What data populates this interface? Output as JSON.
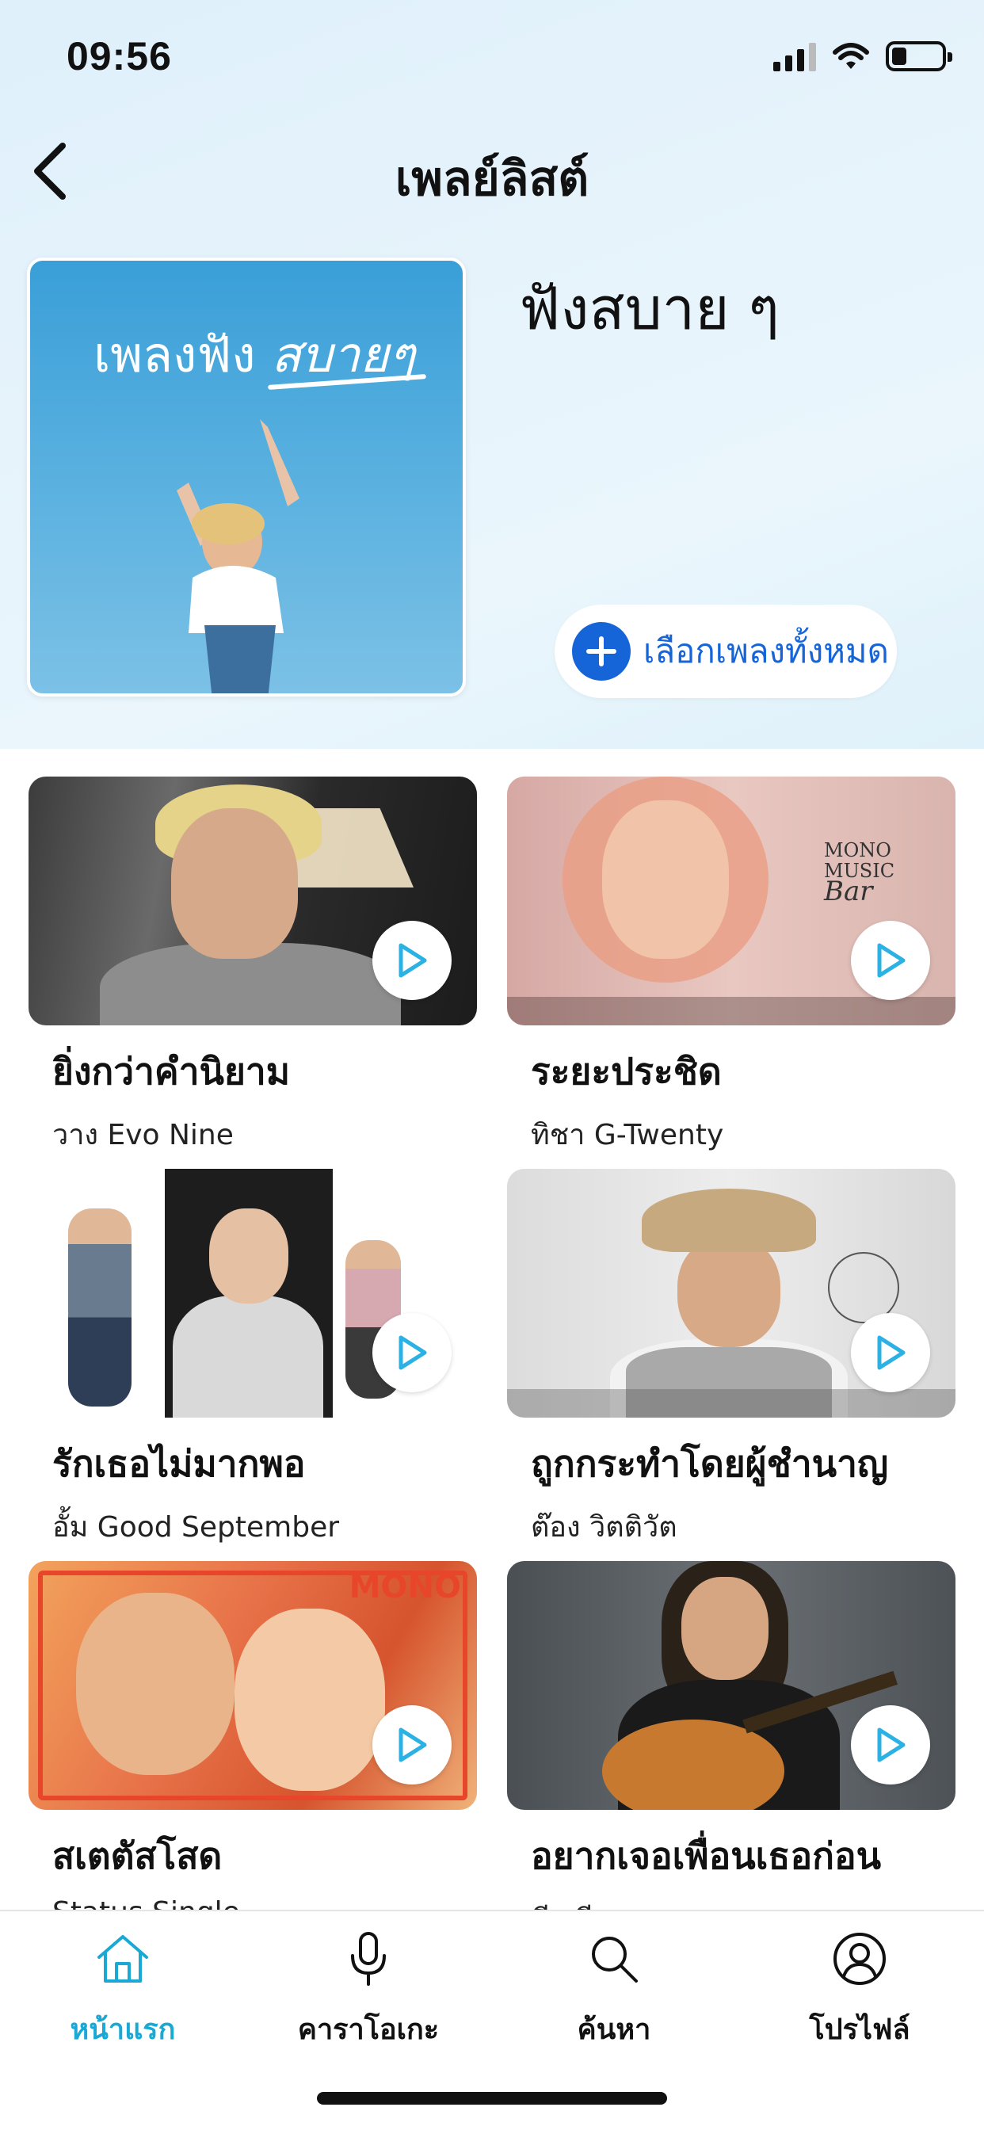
{
  "status": {
    "time": "09:56"
  },
  "nav": {
    "title": "เพลย์ลิสต์",
    "back_icon": "chevron-left-icon"
  },
  "playlist": {
    "cover_text_a": "เพลงฟัง",
    "cover_text_b": "สบายๆ",
    "name": "ฟังสบาย ๆ",
    "select_all_label": "เลือกเพลงทั้งหมด"
  },
  "songs": [
    {
      "title": "ยิ่งกว่าคำนิยาม",
      "artist": "วาง Evo Nine"
    },
    {
      "title": "ระยะประชิด",
      "artist": "ทิชา G-Twenty"
    },
    {
      "title": "รักเธอไม่มากพอ",
      "artist": "อั้ม Good September"
    },
    {
      "title": "ถูกกระทำโดยผู้ชำนาญ",
      "artist": "ต๊อง วิตติวัต"
    },
    {
      "title": "สเตตัสโสด",
      "artist": "Status Single"
    },
    {
      "title": "อยากเจอเพื่อนเธอก่อน",
      "artist": "พีร พีระ"
    }
  ],
  "thumb_text": {
    "mono_music": "MONO",
    "music": "MUSIC",
    "bar": "Bar",
    "mono_logo": "MONO"
  },
  "tabs": [
    {
      "label": "หน้าแรก",
      "icon": "home-icon",
      "active": true
    },
    {
      "label": "คาราโอเกะ",
      "icon": "microphone-icon",
      "active": false
    },
    {
      "label": "ค้นหา",
      "icon": "search-icon",
      "active": false
    },
    {
      "label": "โปรไฟล์",
      "icon": "profile-icon",
      "active": false
    }
  ],
  "colors": {
    "accent": "#1aa8d4",
    "button_blue": "#1565d8",
    "play_icon": "#2bb1e3"
  }
}
